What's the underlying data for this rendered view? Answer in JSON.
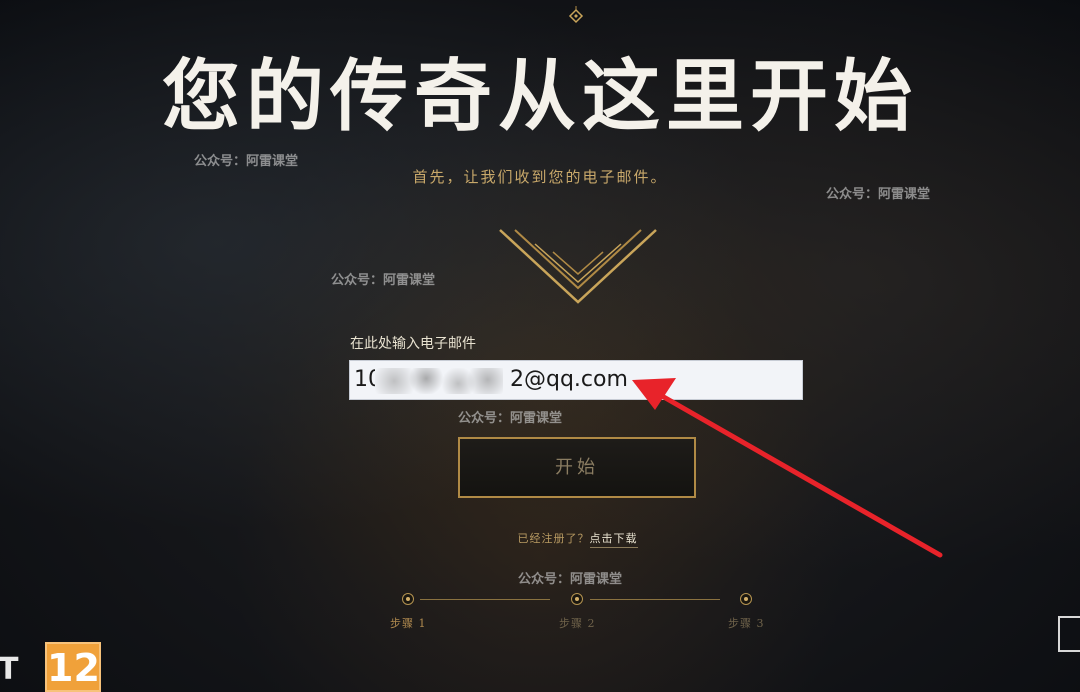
{
  "headline": "您的传奇从这里开始",
  "subtitle": "首先，让我们收到您的电子邮件。",
  "watermark": "公众号：阿雷课堂",
  "email": {
    "label": "在此处输入电子邮件",
    "value_prefix": "10",
    "value_suffix": "2@qq.com"
  },
  "start_button": {
    "label": "开始"
  },
  "registered": {
    "question": "已经注册了？",
    "link": "点击下载"
  },
  "steps": [
    {
      "label": "步骤 1"
    },
    {
      "label": "步骤 2"
    },
    {
      "label": "步骤 3"
    }
  ],
  "rating_badge": "12",
  "corner_text": "T",
  "colors": {
    "gold": "#c8a86a",
    "button_border": "#b08a45",
    "arrow": "#e8232a",
    "rating": "#f0a13a"
  }
}
